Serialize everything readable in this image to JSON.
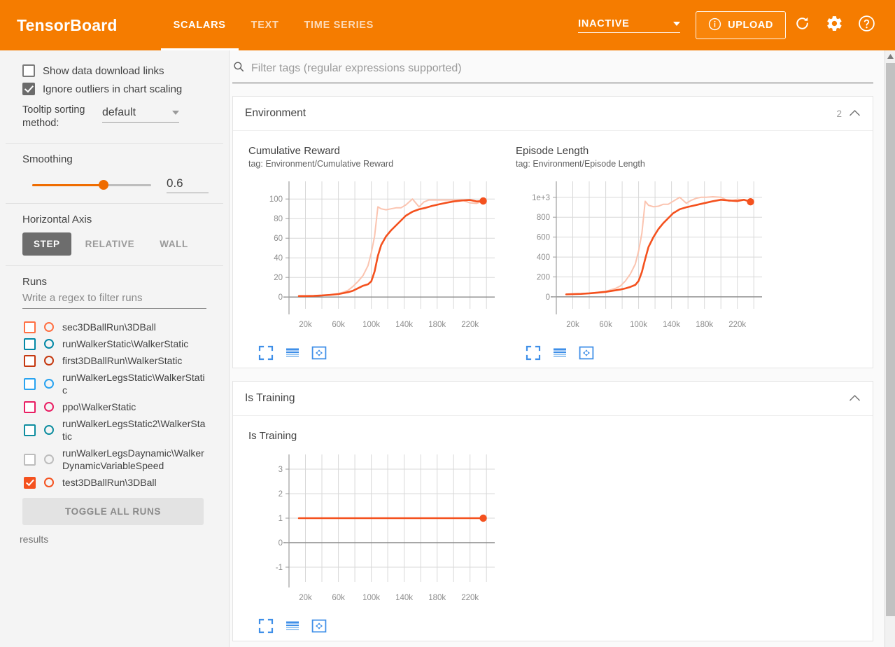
{
  "header": {
    "brand": "TensorBoard",
    "tabs": [
      {
        "label": "SCALARS",
        "active": true
      },
      {
        "label": "TEXT",
        "active": false
      },
      {
        "label": "TIME SERIES",
        "active": false
      }
    ],
    "status": "INACTIVE",
    "upload_label": "UPLOAD",
    "icons": [
      "info-icon",
      "refresh-icon",
      "gear-icon",
      "help-icon"
    ],
    "accent_color": "#f57c00"
  },
  "sidebar": {
    "show_download_links": {
      "label": "Show data download links",
      "checked": false
    },
    "ignore_outliers": {
      "label": "Ignore outliers in chart scaling",
      "checked": true
    },
    "tooltip_sorting": {
      "label": "Tooltip sorting method:",
      "value": "default"
    },
    "smoothing": {
      "label": "Smoothing",
      "value": "0.6",
      "percent": 60
    },
    "horizontal_axis": {
      "label": "Horizontal Axis",
      "options": [
        {
          "label": "STEP",
          "active": true
        },
        {
          "label": "RELATIVE",
          "active": false
        },
        {
          "label": "WALL",
          "active": false
        }
      ]
    },
    "runs": {
      "label": "Runs",
      "filter_placeholder": "Write a regex to filter runs",
      "items": [
        {
          "name": "sec3DBallRun\\3DBall",
          "color": "#ff7043",
          "checked": false
        },
        {
          "name": "runWalkerStatic\\WalkerStatic",
          "color": "#0288a6",
          "checked": false
        },
        {
          "name": "first3DBallRun\\WalkerStatic",
          "color": "#c5380f",
          "checked": false
        },
        {
          "name": "runWalkerLegsStatic\\WalkerStatic",
          "color": "#29a3f0",
          "checked": false
        },
        {
          "name": "ppo\\WalkerStatic",
          "color": "#e91e63",
          "checked": false
        },
        {
          "name": "runWalkerLegsStatic2\\WalkerStatic",
          "color": "#0f8ea0",
          "checked": false
        },
        {
          "name": "runWalkerLegsDaynamic\\WalkerDynamicVariableSpeed",
          "color": "#bdbdbd",
          "checked": false
        },
        {
          "name": "test3DBallRun\\3DBall",
          "color": "#f4511e",
          "checked": true
        }
      ],
      "toggle_all_label": "TOGGLE ALL RUNS",
      "results_text": "results"
    }
  },
  "main": {
    "filter_placeholder": "Filter tags (regular expressions supported)",
    "sections": [
      {
        "title": "Environment",
        "count": "2",
        "collapse_icon": "chevron-up-icon",
        "charts": [
          "cumulative_reward",
          "episode_length"
        ]
      },
      {
        "title": "Is Training",
        "count": "",
        "collapse_icon": "chevron-up-icon",
        "charts": [
          "is_training"
        ]
      }
    ],
    "chart_tools": [
      "expand-icon",
      "data-table-icon",
      "pan-icon"
    ]
  },
  "chart_data": [
    {
      "id": "cumulative_reward",
      "type": "line",
      "title": "Cumulative Reward",
      "subtitle": "tag: Environment/Cumulative Reward",
      "xlabel": "",
      "ylabel": "",
      "xlim": [
        0,
        250000
      ],
      "ylim": [
        -12,
        118
      ],
      "xticks": [
        "20k",
        "60k",
        "100k",
        "140k",
        "180k",
        "220k"
      ],
      "xtick_values": [
        20000,
        60000,
        100000,
        140000,
        180000,
        220000
      ],
      "yticks": [
        0,
        20,
        40,
        60,
        80,
        100
      ],
      "grid": true,
      "legend": "none",
      "series": [
        {
          "name": "test3DBallRun\\3DBall (smoothed)",
          "color": "#f4511e",
          "width": 2.6,
          "x": [
            12000,
            20000,
            30000,
            40000,
            50000,
            60000,
            66000,
            72000,
            78000,
            84000,
            90000,
            96000,
            100000,
            104000,
            108000,
            112000,
            118000,
            124000,
            130000,
            136000,
            142000,
            150000,
            158000,
            166000,
            174000,
            182000,
            190000,
            200000,
            210000,
            220000,
            228000,
            236000
          ],
          "y": [
            1,
            1,
            1.2,
            1.6,
            2.2,
            3,
            4,
            5,
            6.5,
            9,
            11.5,
            13,
            16,
            26,
            42,
            53,
            62,
            68,
            73,
            78,
            83,
            87,
            89.5,
            91,
            93,
            94.5,
            96,
            97.5,
            98.5,
            99,
            97.5,
            98
          ]
        },
        {
          "name": "test3DBallRun\\3DBall (raw)",
          "color": "#fbc4b0",
          "width": 2.0,
          "x": [
            12000,
            20000,
            30000,
            40000,
            50000,
            60000,
            66000,
            72000,
            78000,
            84000,
            90000,
            96000,
            100000,
            104000,
            108000,
            112000,
            118000,
            124000,
            130000,
            136000,
            142000,
            150000,
            158000,
            164000,
            170000,
            176000,
            182000,
            190000,
            200000,
            210000,
            220000,
            228000,
            236000
          ],
          "y": [
            1,
            1,
            1.2,
            1.6,
            2.5,
            3.5,
            5,
            7,
            11,
            16,
            22,
            32,
            45,
            62,
            92,
            90,
            89,
            90,
            91,
            91,
            94,
            100,
            92,
            97,
            99,
            99,
            99,
            99,
            99,
            99,
            96,
            95.5,
            98
          ]
        }
      ],
      "marker": {
        "x": 236000,
        "y": 98,
        "color": "#f4511e"
      }
    },
    {
      "id": "episode_length",
      "type": "line",
      "title": "Episode Length",
      "subtitle": "tag: Environment/Episode Length",
      "xlabel": "",
      "ylabel": "",
      "xlim": [
        0,
        250000
      ],
      "ylim": [
        -120,
        1160
      ],
      "xticks": [
        "20k",
        "60k",
        "100k",
        "140k",
        "180k",
        "220k"
      ],
      "xtick_values": [
        20000,
        60000,
        100000,
        140000,
        180000,
        220000
      ],
      "yticks": [
        0,
        200,
        400,
        600,
        800,
        1000
      ],
      "ytick_labels": [
        "0",
        "200",
        "400",
        "600",
        "800",
        "1e+3"
      ],
      "grid": true,
      "legend": "none",
      "series": [
        {
          "name": "test3DBallRun\\3DBall (smoothed)",
          "color": "#f4511e",
          "width": 2.6,
          "x": [
            12000,
            20000,
            30000,
            40000,
            50000,
            60000,
            66000,
            72000,
            78000,
            84000,
            90000,
            96000,
            100000,
            104000,
            108000,
            112000,
            118000,
            124000,
            130000,
            136000,
            142000,
            150000,
            158000,
            166000,
            174000,
            182000,
            190000,
            200000,
            210000,
            220000,
            228000,
            236000
          ],
          "y": [
            25,
            27,
            30,
            35,
            42,
            50,
            58,
            66,
            74,
            85,
            100,
            120,
            160,
            250,
            380,
            500,
            600,
            680,
            740,
            790,
            840,
            880,
            900,
            915,
            930,
            945,
            960,
            975,
            968,
            962,
            975,
            955
          ]
        },
        {
          "name": "test3DBallRun\\3DBall (raw)",
          "color": "#fbc4b0",
          "width": 2.0,
          "x": [
            12000,
            20000,
            30000,
            40000,
            50000,
            60000,
            66000,
            72000,
            78000,
            84000,
            90000,
            96000,
            100000,
            104000,
            108000,
            112000,
            118000,
            124000,
            130000,
            136000,
            142000,
            150000,
            158000,
            164000,
            170000,
            176000,
            182000,
            190000,
            200000,
            210000,
            220000,
            228000,
            236000
          ],
          "y": [
            25,
            27,
            30,
            36,
            45,
            55,
            70,
            85,
            110,
            160,
            230,
            330,
            460,
            640,
            960,
            920,
            905,
            910,
            930,
            930,
            960,
            1000,
            940,
            970,
            990,
            1000,
            1000,
            1005,
            1000,
            960,
            980,
            975,
            955
          ]
        }
      ],
      "marker": {
        "x": 236000,
        "y": 955,
        "color": "#f4511e"
      }
    },
    {
      "id": "is_training",
      "type": "line",
      "title": "Is Training",
      "subtitle": "",
      "xlabel": "",
      "ylabel": "",
      "xlim": [
        0,
        250000
      ],
      "ylim": [
        -1.6,
        3.6
      ],
      "xticks": [
        "20k",
        "60k",
        "100k",
        "140k",
        "180k",
        "220k"
      ],
      "xtick_values": [
        20000,
        60000,
        100000,
        140000,
        180000,
        220000
      ],
      "yticks": [
        -1,
        0,
        1,
        2,
        3
      ],
      "grid": true,
      "legend": "none",
      "series": [
        {
          "name": "test3DBallRun\\3DBall",
          "color": "#f4511e",
          "width": 2.6,
          "x": [
            12000,
            236000
          ],
          "y": [
            1,
            1
          ]
        }
      ],
      "marker": {
        "x": 236000,
        "y": 1,
        "color": "#f4511e"
      }
    }
  ]
}
